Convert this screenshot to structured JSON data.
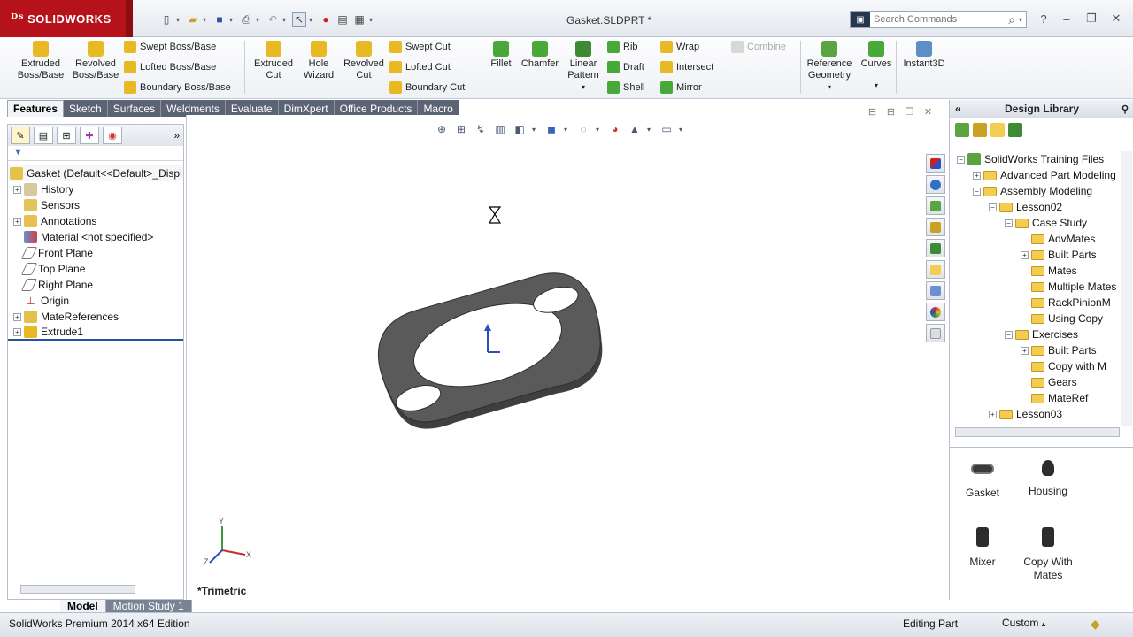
{
  "app": {
    "logo_text": "SOLIDWORKS",
    "doc_title": "Gasket.SLDPRT *"
  },
  "search": {
    "placeholder": "Search Commands"
  },
  "commands": {
    "extruded_boss": "Extruded\nBoss/Base",
    "revolved_boss": "Revolved\nBoss/Base",
    "swept_boss": "Swept Boss/Base",
    "lofted_boss": "Lofted Boss/Base",
    "boundary_boss": "Boundary Boss/Base",
    "extruded_cut": "Extruded\nCut",
    "hole_wizard": "Hole\nWizard",
    "revolved_cut": "Revolved\nCut",
    "swept_cut": "Swept Cut",
    "lofted_cut": "Lofted Cut",
    "boundary_cut": "Boundary Cut",
    "fillet": "Fillet",
    "chamfer": "Chamfer",
    "linear_pattern": "Linear\nPattern",
    "rib": "Rib",
    "draft": "Draft",
    "shell": "Shell",
    "wrap": "Wrap",
    "intersect": "Intersect",
    "mirror": "Mirror",
    "combine": "Combine",
    "reference_geometry": "Reference\nGeometry",
    "curves": "Curves",
    "instant3d": "Instant3D"
  },
  "tabs": [
    "Features",
    "Sketch",
    "Surfaces",
    "Weldments",
    "Evaluate",
    "DimXpert",
    "Office Products",
    "Macro"
  ],
  "feature_tree": {
    "root": "Gasket  (Default<<Default>_Displ",
    "items": [
      "History",
      "Sensors",
      "Annotations",
      "Material <not specified>",
      "Front Plane",
      "Top Plane",
      "Right Plane",
      "Origin",
      "MateReferences",
      "Extrude1"
    ]
  },
  "viewport": {
    "view_label": "*Trimetric",
    "axis_x": "X",
    "axis_y": "Y",
    "axis_z": "Z"
  },
  "design_library": {
    "title": "Design Library",
    "tree": [
      "SolidWorks Training Files",
      "Advanced Part Modeling",
      "Assembly Modeling",
      "Lesson02",
      "Case Study",
      "AdvMates",
      "Built Parts",
      "Mates",
      "Multiple Mates",
      "RackPinionM",
      "Using Copy",
      "Exercises",
      "Built Parts",
      "Copy with M",
      "Gears",
      "MateRef",
      "Lesson03"
    ],
    "items": [
      "Gasket",
      "Housing",
      "Mixer",
      "Copy With\nMates"
    ]
  },
  "bottom_tabs": [
    "Model",
    "Motion Study 1"
  ],
  "status": {
    "edition": "SolidWorks Premium 2014 x64 Edition",
    "mode": "Editing Part",
    "custom": "Custom"
  },
  "colors": {
    "brand_red": "#b5121b",
    "tab_dark": "#5b6474",
    "part_gray": "#4a4a4a"
  }
}
